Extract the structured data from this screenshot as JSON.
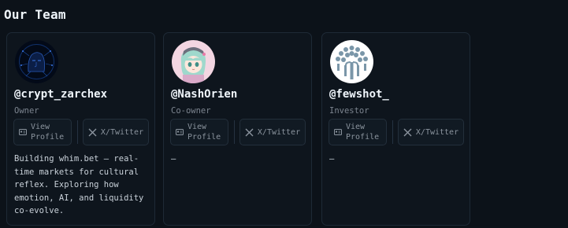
{
  "section": {
    "title": "Our Team"
  },
  "colors": {
    "background": "#0c1219",
    "card_border": "#1e2a36",
    "muted_text": "#7d8590"
  },
  "members": [
    {
      "handle": "@crypt_zarchex",
      "role": "Owner",
      "view_profile_label": "View Profile",
      "view_profile_line1": "View",
      "view_profile_line2": "Profile",
      "twitter_label": "X/Twitter",
      "bio": "Building whim.bet — real-time markets for cultural reflex. Exploring how emotion, AI, and liquidity co-evolve.",
      "avatar_icon": "circuit-face-avatar"
    },
    {
      "handle": "@NashOrien",
      "role": "Co-owner",
      "view_profile_line1": "View",
      "view_profile_line2": "Profile",
      "twitter_label": "X/Twitter",
      "bio": "–",
      "avatar_icon": "anime-character-avatar"
    },
    {
      "handle": "@fewshot_",
      "role": "Investor",
      "view_profile_line1": "View",
      "view_profile_line2": "Profile",
      "twitter_label": "X/Twitter",
      "bio": "–",
      "avatar_icon": "tree-logo-avatar"
    }
  ]
}
